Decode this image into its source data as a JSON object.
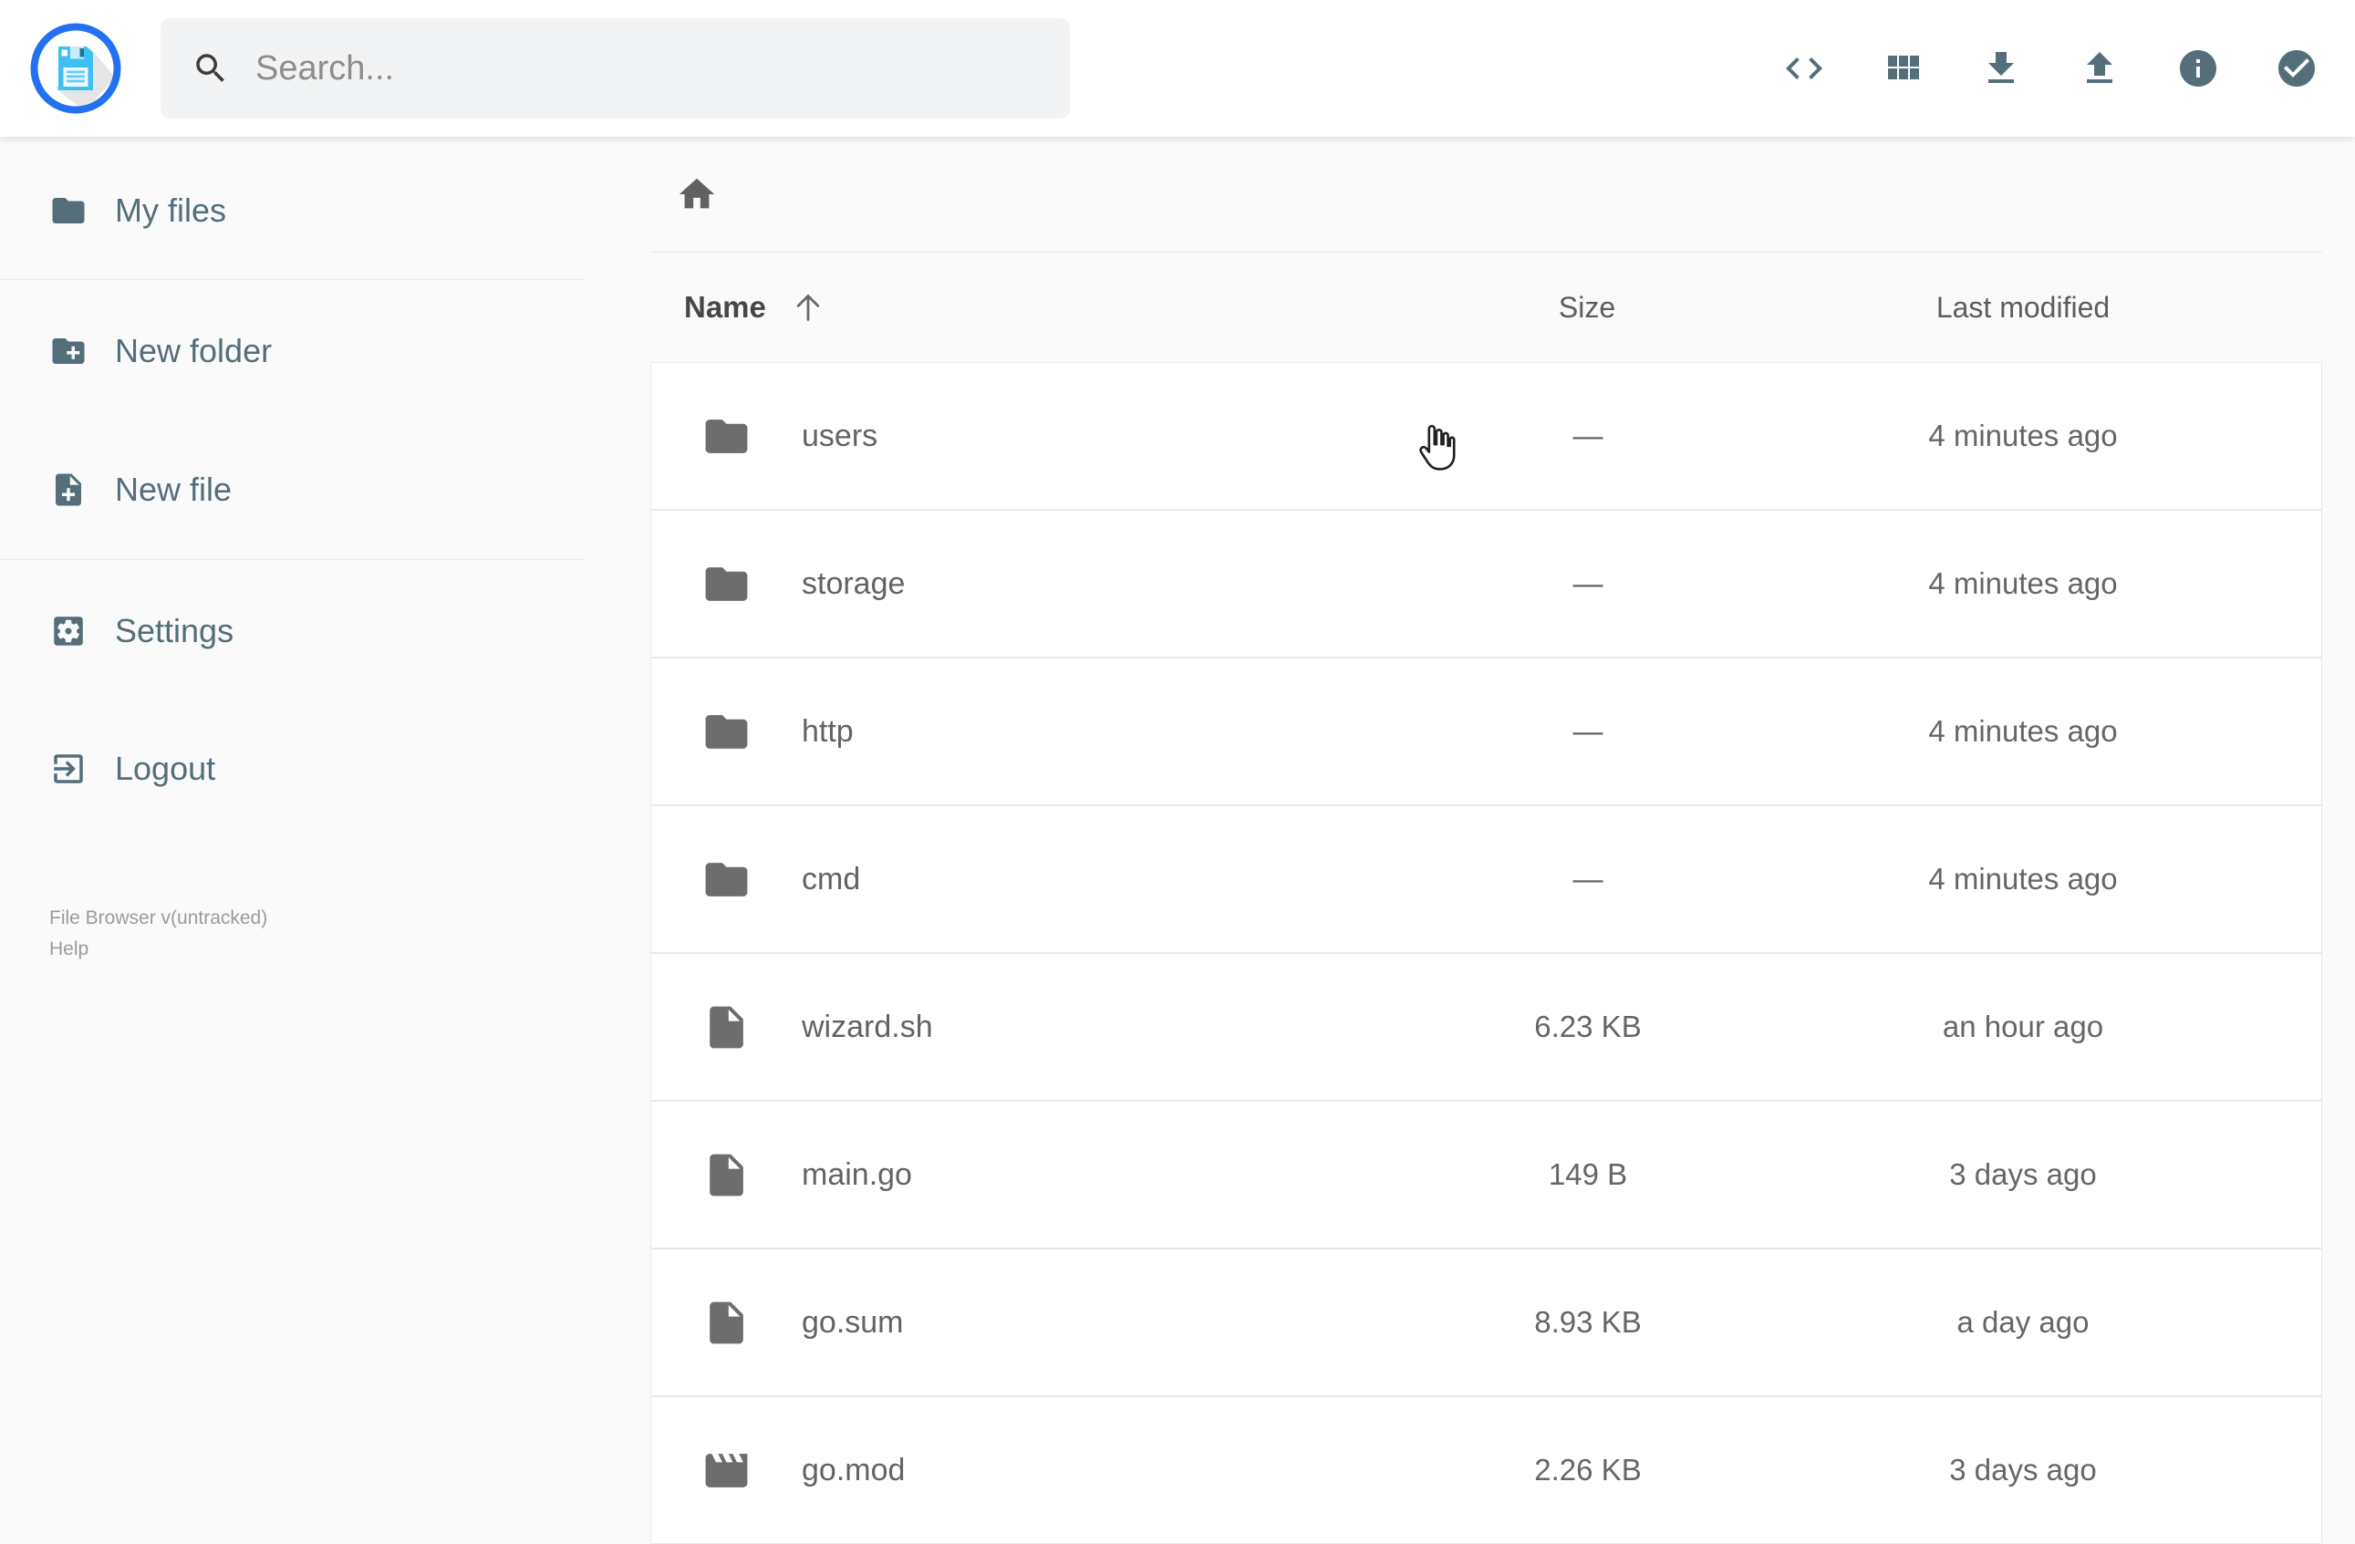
{
  "header": {
    "logo_icon": "floppy-disk-logo",
    "search": {
      "placeholder": "Search...",
      "icon": "search-icon"
    },
    "actions": [
      {
        "id": "raw-view",
        "icon": "code-icon"
      },
      {
        "id": "switch-view",
        "icon": "grid-view-icon"
      },
      {
        "id": "download",
        "icon": "download-icon"
      },
      {
        "id": "upload",
        "icon": "upload-icon"
      },
      {
        "id": "info",
        "icon": "info-icon"
      },
      {
        "id": "select-multiple",
        "icon": "check-circle-icon"
      }
    ]
  },
  "sidebar": {
    "items": [
      {
        "label": "My files",
        "icon": "folder-icon"
      },
      {
        "label": "New folder",
        "icon": "new-folder-icon"
      },
      {
        "label": "New file",
        "icon": "new-file-icon"
      },
      {
        "label": "Settings",
        "icon": "settings-icon"
      },
      {
        "label": "Logout",
        "icon": "logout-icon"
      }
    ],
    "footer": {
      "version": "File Browser v(untracked)",
      "help": "Help"
    }
  },
  "breadcrumb": {
    "home_icon": "home-icon"
  },
  "listing": {
    "columns": {
      "name": "Name",
      "size": "Size",
      "modified": "Last modified"
    },
    "sort": {
      "column": "Name",
      "direction": "asc",
      "icon": "sort-arrow-up-icon"
    },
    "rows": [
      {
        "name": "users",
        "icon": "folder-icon",
        "size": "—",
        "modified": "4 minutes ago"
      },
      {
        "name": "storage",
        "icon": "folder-icon",
        "size": "—",
        "modified": "4 minutes ago"
      },
      {
        "name": "http",
        "icon": "folder-icon",
        "size": "—",
        "modified": "4 minutes ago"
      },
      {
        "name": "cmd",
        "icon": "folder-icon",
        "size": "—",
        "modified": "4 minutes ago"
      },
      {
        "name": "wizard.sh",
        "icon": "file-icon",
        "size": "6.23 KB",
        "modified": "an hour ago"
      },
      {
        "name": "main.go",
        "icon": "file-icon",
        "size": "149 B",
        "modified": "3 days ago"
      },
      {
        "name": "go.sum",
        "icon": "file-icon",
        "size": "8.93 KB",
        "modified": "a day ago"
      },
      {
        "name": "go.mod",
        "icon": "movie-icon",
        "size": "2.26 KB",
        "modified": "3 days ago"
      }
    ]
  },
  "colors": {
    "accent_blue": "#2371f0",
    "floppy_cyan": "#3ec0f4",
    "toolbar_icon": "#546e7a",
    "row_text": "#636363",
    "background": "#fafafa",
    "row_background": "#ffffff",
    "divider": "#e8e8e8",
    "footer_text": "#9b9b9b"
  }
}
